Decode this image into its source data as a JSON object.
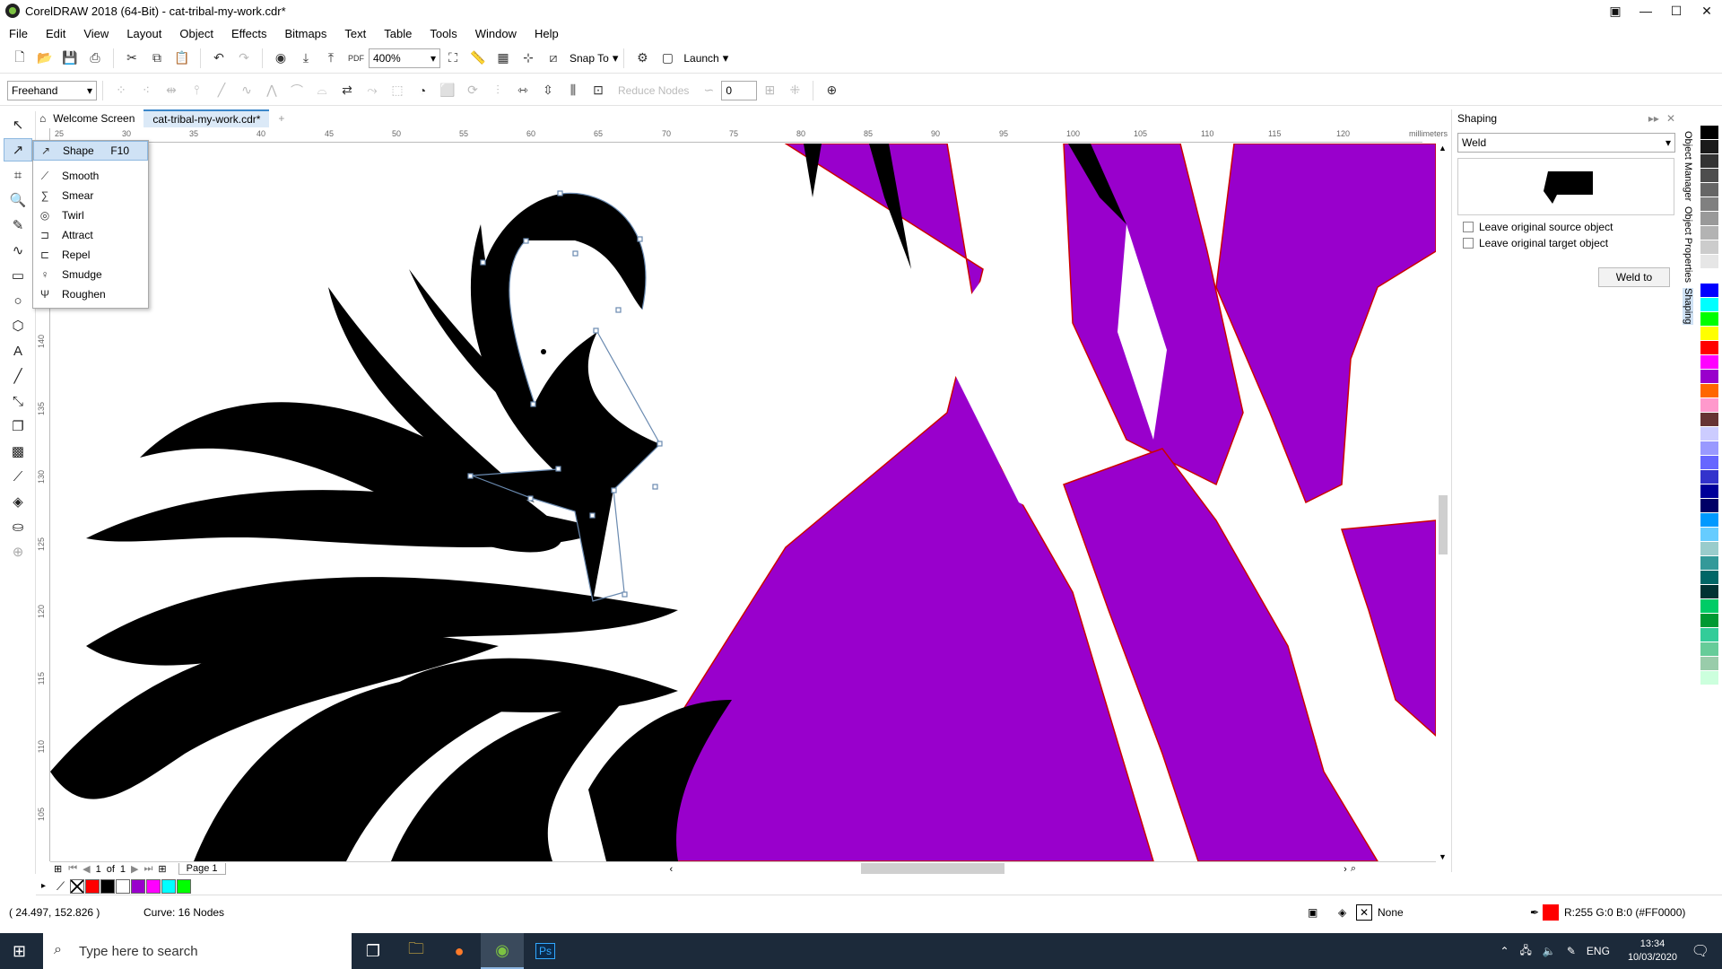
{
  "window": {
    "title": "CorelDRAW 2018 (64-Bit) - cat-tribal-my-work.cdr*",
    "controls": [
      "▣",
      "—",
      "☐",
      "✕"
    ]
  },
  "menu": [
    "File",
    "Edit",
    "View",
    "Layout",
    "Object",
    "Effects",
    "Bitmaps",
    "Text",
    "Table",
    "Tools",
    "Window",
    "Help"
  ],
  "toolbar1": {
    "zoom": "400%",
    "snap_to": "Snap To",
    "launch": "Launch",
    "pdf": "PDF"
  },
  "toolbar2": {
    "mode": "Freehand",
    "reduce_nodes": "Reduce Nodes",
    "smoothness": "0"
  },
  "tabs": [
    "Welcome Screen",
    "cat-tribal-my-work.cdr*"
  ],
  "ruler": {
    "unit": "millimeters",
    "h_ticks": [
      "25",
      "30",
      "35",
      "40",
      "45",
      "50",
      "55",
      "60",
      "65",
      "70",
      "75",
      "80",
      "85",
      "90",
      "95",
      "100",
      "105",
      "110",
      "115",
      "120"
    ],
    "v_ticks": [
      "140",
      "135",
      "130",
      "125",
      "120",
      "115",
      "110",
      "105"
    ]
  },
  "flyout": {
    "items": [
      {
        "label": "Shape",
        "shortcut": "F10",
        "icon": "shape-icon"
      },
      {
        "label": "Smooth",
        "shortcut": "",
        "icon": "smooth-icon"
      },
      {
        "label": "Smear",
        "shortcut": "",
        "icon": "smear-icon"
      },
      {
        "label": "Twirl",
        "shortcut": "",
        "icon": "twirl-icon"
      },
      {
        "label": "Attract",
        "shortcut": "",
        "icon": "attract-icon"
      },
      {
        "label": "Repel",
        "shortcut": "",
        "icon": "repel-icon"
      },
      {
        "label": "Smudge",
        "shortcut": "",
        "icon": "smudge-icon"
      },
      {
        "label": "Roughen",
        "shortcut": "",
        "icon": "roughen-icon"
      }
    ]
  },
  "docker": {
    "title": "Shaping",
    "operation": "Weld",
    "leave_source": "Leave original source object",
    "leave_target": "Leave original target object",
    "button": "Weld to",
    "side_tabs": [
      "Object Manager",
      "Object Properties",
      "Shaping"
    ]
  },
  "pages": {
    "current": "1",
    "of": "of",
    "total": "1",
    "tab": "Page 1"
  },
  "status": {
    "coords": "( 24.497, 152.826 )",
    "selection": "Curve: 16 Nodes",
    "fill": "None",
    "outline": "R:255 G:0 B:0 (#FF0000)"
  },
  "taskbar": {
    "search_placeholder": "Type here to search",
    "lang": "ENG",
    "time": "13:34",
    "date": "10/03/2020",
    "ps_label": "Ps"
  },
  "colors": {
    "purple": "#9900cc",
    "accent": "#3b87c9",
    "outline": "#FF0000"
  },
  "doc_palette": [
    "#ff0000",
    "#000000",
    "#ffffff",
    "#9900cc",
    "#ff00ff",
    "#00ffff",
    "#00ff00"
  ],
  "palette": [
    "#000000",
    "#1a1a1a",
    "#333333",
    "#4d4d4d",
    "#666666",
    "#808080",
    "#999999",
    "#b3b3b3",
    "#cccccc",
    "#e6e6e6",
    "#ffffff",
    "#0000ff",
    "#00ffff",
    "#00ff00",
    "#ffff00",
    "#ff0000",
    "#ff00ff",
    "#9900cc",
    "#ff6600",
    "#ff99cc",
    "#663333",
    "#ccccff",
    "#9999ff",
    "#6666ff",
    "#3333cc",
    "#000099",
    "#000066",
    "#0099ff",
    "#66ccff",
    "#99cccc",
    "#339999",
    "#006666",
    "#003333",
    "#00cc66",
    "#009933",
    "#33cc99",
    "#66cc99",
    "#99ccaa",
    "#ccffdd"
  ]
}
